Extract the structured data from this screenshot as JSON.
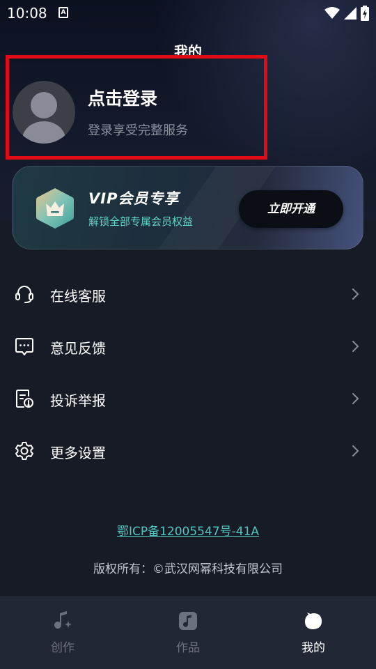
{
  "status_bar": {
    "time": "10:08",
    "notification_icon": "A"
  },
  "page": {
    "title": "我的"
  },
  "login": {
    "title": "点击登录",
    "subtitle": "登录享受完整服务"
  },
  "vip": {
    "title": "VIP会员专享",
    "subtitle": "解锁全部专属会员权益",
    "button_label": "立即开通"
  },
  "menu": {
    "items": [
      {
        "label": "在线客服",
        "icon": "headset-icon"
      },
      {
        "label": "意见反馈",
        "icon": "message-icon"
      },
      {
        "label": "投诉举报",
        "icon": "report-icon"
      },
      {
        "label": "更多设置",
        "icon": "gear-icon"
      }
    ]
  },
  "footer": {
    "icp": "鄂ICP备12005547号-41A",
    "copyright": "版权所有：©武汉网幂科技有限公司"
  },
  "tabs": [
    {
      "label": "创作",
      "icon": "music-note-sparkle-icon",
      "active": false
    },
    {
      "label": "作品",
      "icon": "music-file-icon",
      "active": false
    },
    {
      "label": "我的",
      "icon": "profile-blob-icon",
      "active": true
    }
  ],
  "colors": {
    "background": "#121722",
    "accent_teal": "#4fc6c0",
    "highlight_border": "#e00b14",
    "tab_bar": "#222735"
  }
}
